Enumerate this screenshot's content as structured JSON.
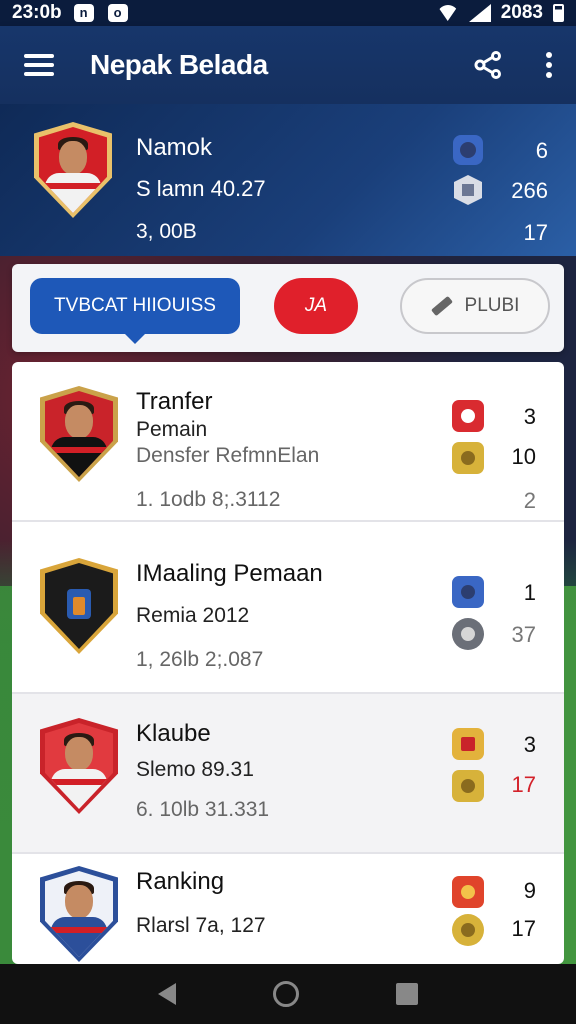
{
  "status_bar": {
    "time": "23:0b",
    "icon_a": "n",
    "icon_b": "o",
    "right_text": "2083"
  },
  "app_bar": {
    "title": "Nepak Belada",
    "menu_icon": "hamburger-icon",
    "share_icon": "share-icon",
    "more_icon": "kebab-icon"
  },
  "profile": {
    "name": "Namok",
    "subtitle": "S lamn 40.27",
    "amount": "3, 00B",
    "stats": [
      "6",
      "266",
      "17"
    ]
  },
  "tabs": {
    "primary": "TVBCAT HIIOUISS",
    "red": "JA",
    "outline": "PLUBI"
  },
  "cards": [
    {
      "title": "Tranfer",
      "line2": "Pemain",
      "line3": "Densfer RefmnElan",
      "line4": "1. 1odb 8;.3112",
      "stats": [
        "3",
        "10",
        "2"
      ]
    },
    {
      "title": "IMaaling Pemaan",
      "line2": "Remia 2012",
      "line3": "1, 26lb 2;.087",
      "stats": [
        "1",
        "37"
      ]
    },
    {
      "title": "Klaube",
      "line2": "Slemo 89.31",
      "line3": "6. 10lb 31.331",
      "stats": [
        "3",
        "17"
      ]
    },
    {
      "title": "Ranking",
      "line2": "Rlarsl 7a, 127",
      "stats": [
        "9",
        "17"
      ]
    }
  ],
  "colors": {
    "primary": "#1e58b8",
    "accent_red": "#e0202b",
    "header": "#15305f"
  }
}
